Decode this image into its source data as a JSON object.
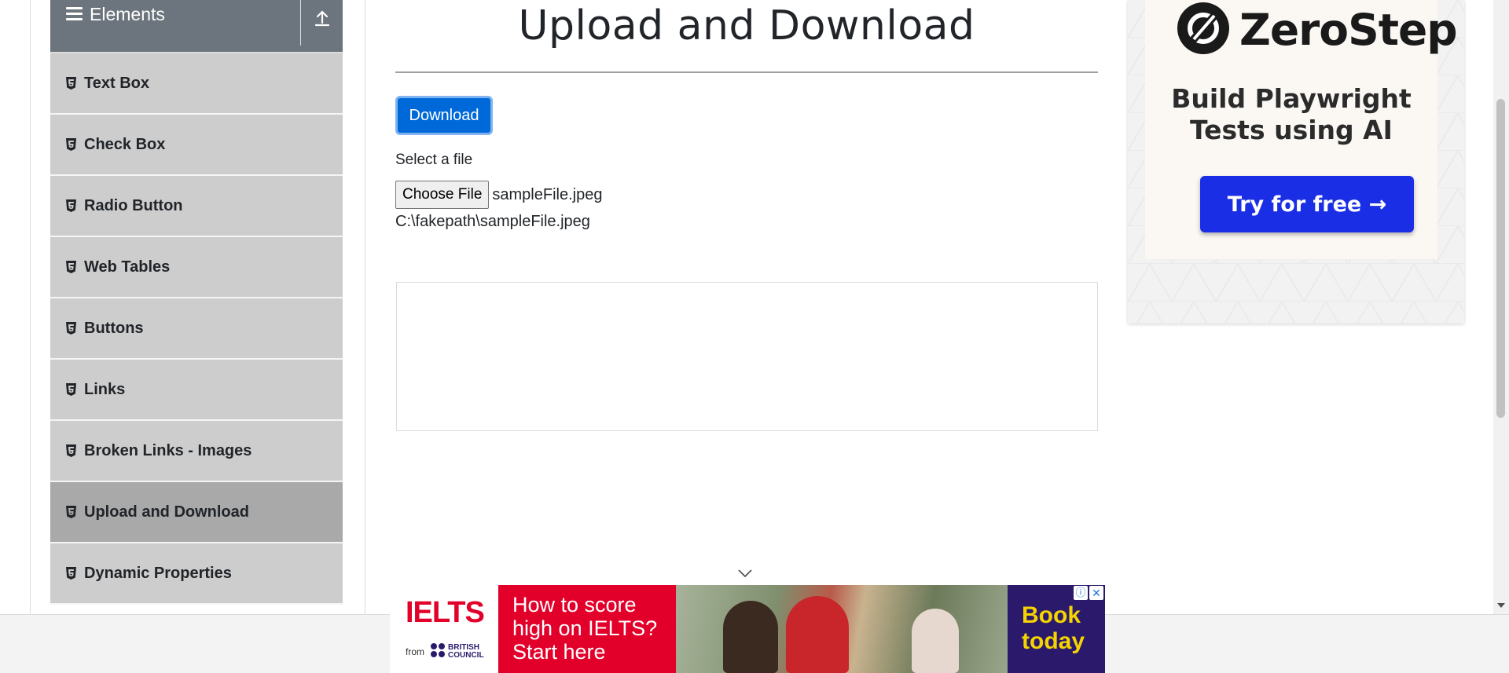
{
  "sidebar": {
    "group_title": "Elements",
    "items": [
      {
        "label": "Text Box",
        "active": false
      },
      {
        "label": "Check Box",
        "active": false
      },
      {
        "label": "Radio Button",
        "active": false
      },
      {
        "label": "Web Tables",
        "active": false
      },
      {
        "label": "Buttons",
        "active": false
      },
      {
        "label": "Links",
        "active": false
      },
      {
        "label": "Broken Links - Images",
        "active": false
      },
      {
        "label": "Upload and Download",
        "active": true
      },
      {
        "label": "Dynamic Properties",
        "active": false
      }
    ]
  },
  "main": {
    "title": "Upload and Download",
    "download_label": "Download",
    "select_label": "Select a file",
    "choose_file_label": "Choose File",
    "file_name": "sampleFile.jpeg",
    "uploaded_path": "C:\\fakepath\\sampleFile.jpeg"
  },
  "ad_right": {
    "brand": "ZeroStep",
    "tagline_line1": "Build Playwright",
    "tagline_line2": "Tests using AI",
    "cta": "Try for free →"
  },
  "ad_bottom": {
    "logo": "IELTS",
    "from": "from",
    "partner_line1": "BRITISH",
    "partner_line2": "COUNCIL",
    "headline": "How to score high on IELTS? Start here",
    "cta_line1": "Book",
    "cta_line2": "today",
    "info_icon": "ⓘ",
    "close_icon": "✕"
  },
  "colors": {
    "sidebar_header": "#6c757d",
    "sidebar_item": "#cdcdcd",
    "sidebar_item_active": "#a9a9a9",
    "primary_button": "#0069d9",
    "ad_cta_blue": "#1a2ee6",
    "ielts_red": "#e2002b",
    "ielts_purple": "#2b1a6b"
  }
}
